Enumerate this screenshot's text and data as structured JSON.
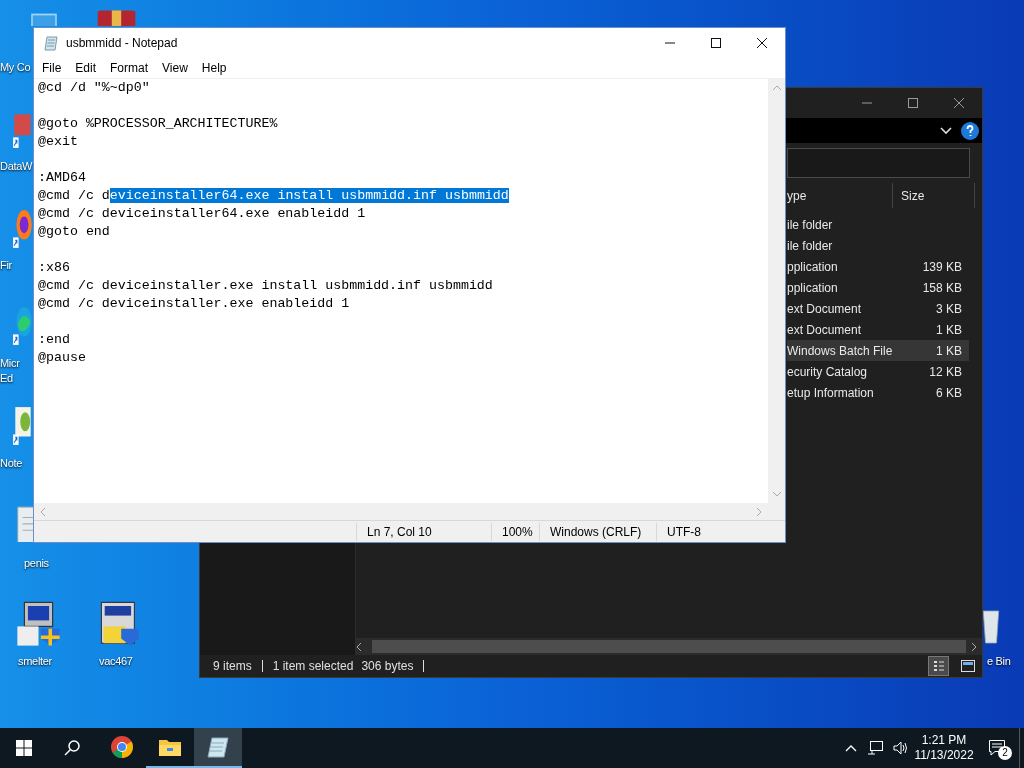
{
  "desktop_icons": [
    {
      "kind": "computer",
      "lines": [
        "My Co"
      ]
    },
    {
      "kind": "archive"
    },
    {
      "kind": "shortcut",
      "lines": [
        "DataW"
      ]
    },
    {
      "kind": "firefox",
      "lines": [
        "Fir"
      ]
    },
    {
      "kind": "edge",
      "lines": [
        "Micr",
        "Ed"
      ]
    },
    {
      "kind": "notepadpp",
      "lines": [
        "Note"
      ]
    },
    {
      "kind": "textfile",
      "lines": [
        "penis"
      ]
    },
    {
      "kind": "installer",
      "lines": [
        "smelter"
      ]
    },
    {
      "kind": "sevenzip",
      "lines": [
        "vac467"
      ]
    },
    {
      "kind": "bin",
      "lines": [
        "e Bin"
      ]
    }
  ],
  "explorer": {
    "columns": [
      "ype",
      "Size"
    ],
    "rows": [
      {
        "type": "ile folder",
        "selected": false
      },
      {
        "type": "ile folder",
        "selected": false
      },
      {
        "type": "pplication",
        "size": "139 KB",
        "selected": false
      },
      {
        "type": "pplication",
        "size": "158 KB",
        "selected": false
      },
      {
        "type": "ext Document",
        "size": "3 KB",
        "selected": false
      },
      {
        "type": "ext Document",
        "size": "1 KB",
        "selected": false
      },
      {
        "type": "Windows Batch File",
        "size": "1 KB",
        "selected": true
      },
      {
        "type": "ecurity Catalog",
        "size": "12 KB",
        "selected": false
      },
      {
        "type": "etup Information",
        "size": "6 KB",
        "selected": false
      }
    ],
    "status_bar": {
      "item_count": "9 items",
      "selection": "1 item selected",
      "size": "306 bytes"
    },
    "views": [
      {
        "kind": "details",
        "selected": true
      },
      {
        "kind": "tiles",
        "selected": false
      }
    ]
  },
  "notepad": {
    "title": "usbmmidd - Notepad",
    "menu": [
      "File",
      "Edit",
      "Format",
      "View",
      "Help"
    ],
    "before_selection": "@cd /d \"%~dp0\"\n\n@goto %PROCESSOR_ARCHITECTURE%\n@exit\n\n:AMD64\n@cmd /c d",
    "selection": "eviceinstaller64.exe install usbmmidd.inf usbmmidd",
    "after_selection": "\n@cmd /c deviceinstaller64.exe enableidd 1\n@goto end\n\n:x86\n@cmd /c deviceinstaller.exe install usbmmidd.inf usbmmidd\n@cmd /c deviceinstaller.exe enableidd 1\n\n:end\n@pause",
    "status": [
      "Ln 7, Col 10",
      "100%",
      "Windows (CRLF)",
      "UTF-8"
    ]
  },
  "taskbar": {
    "apps": [
      {
        "kind": "chrome",
        "running": false,
        "active": false
      },
      {
        "kind": "explorer",
        "running": true,
        "active": false
      },
      {
        "kind": "notepad",
        "running": true,
        "active": true
      }
    ],
    "time": "1:21 PM",
    "date": "11/13/2022",
    "notifications": "2"
  }
}
